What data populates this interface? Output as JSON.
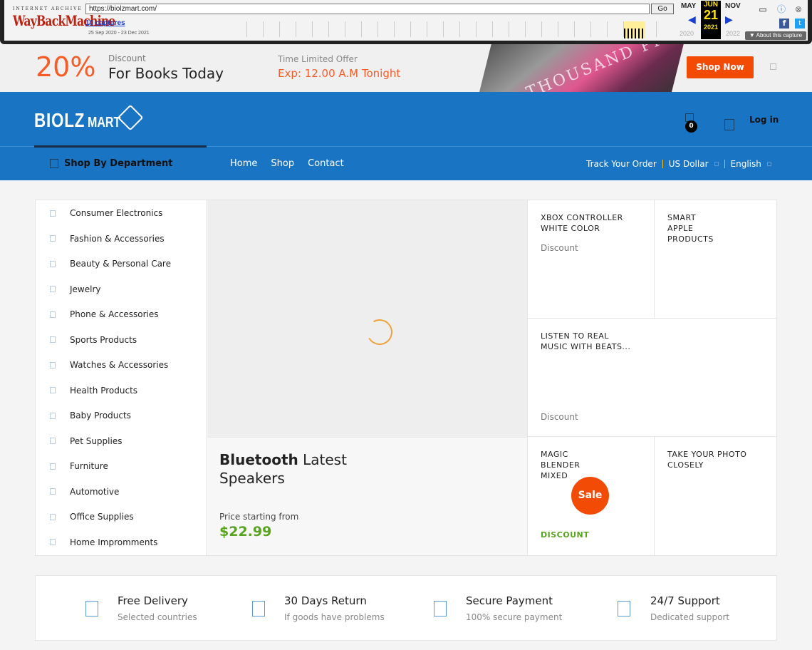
{
  "wayback": {
    "logo_top": "INTERNET ARCHIVE",
    "logo": "WayBackMachine",
    "url": "https://biolzmart.com/",
    "go_label": "Go",
    "captures": "10 captures",
    "range": "25 Sep 2020 - 23 Dec 2021",
    "prev_month": "MAY",
    "cur_month": "JUN",
    "next_month": "NOV",
    "day": "21",
    "prev_year": "2020",
    "cur_year": "2021",
    "next_year": "2022",
    "about": "▼ About this capture",
    "fb": "f",
    "tw": "t"
  },
  "promo": {
    "percent": "20%",
    "discount_label": "Discount",
    "title": "For Books Today",
    "offer_label": "Time Limited Offer",
    "expiry": "Exp: 12.00 A.M Tonight",
    "book_text": "THOUSAND PIECES",
    "button": "Shop Now"
  },
  "header": {
    "logo_main": "BIOLZ",
    "logo_sub": "MART",
    "cart_count": "0",
    "login": "Log in",
    "department": "Shop By Department",
    "nav": [
      "Home",
      "Shop",
      "Contact"
    ],
    "track": "Track Your Order",
    "currency": "US Dollar",
    "language": "English"
  },
  "categories": [
    "Consumer Electronics",
    "Fashion & Accessories",
    "Beauty & Personal Care",
    "Jewelry",
    "Phone & Accessories",
    "Sports Products",
    "Watches & Accessories",
    "Health Products",
    "Baby Products",
    "Pet Supplies",
    "Furniture",
    "Automotive",
    "Office Supplies",
    "Home Impromments"
  ],
  "feature_card": {
    "title_bold": "Bluetooth",
    "title_rest": " Latest Speakers",
    "price_label": "Price starting from",
    "price": "$22.99"
  },
  "tiles": {
    "xbox_title": "XBOX CONTROLLER WHITE COLOR",
    "xbox_discount": "Discount",
    "apple_title": "SMART APPLE PRODUCTS",
    "beats_title": "LISTEN TO REAL MUSIC WITH BEATS...",
    "beats_discount": "Discount",
    "blender_title": "MAGIC BLENDER MIXED",
    "sale": "Sale",
    "blender_discount": "DISCOUNT",
    "photo_title": "TAKE YOUR PHOTO CLOSELY"
  },
  "features": [
    {
      "title": "Free Delivery",
      "sub": "Selected countries"
    },
    {
      "title": "30 Days Return",
      "sub": "If goods have problems"
    },
    {
      "title": "Secure Payment",
      "sub": "100% secure payment"
    },
    {
      "title": "24/7 Support",
      "sub": "Dedicated support"
    }
  ],
  "colors": {
    "brand_blue": "#1a74c4",
    "accent_orange": "#f14b06",
    "price_green": "#5aa321"
  }
}
